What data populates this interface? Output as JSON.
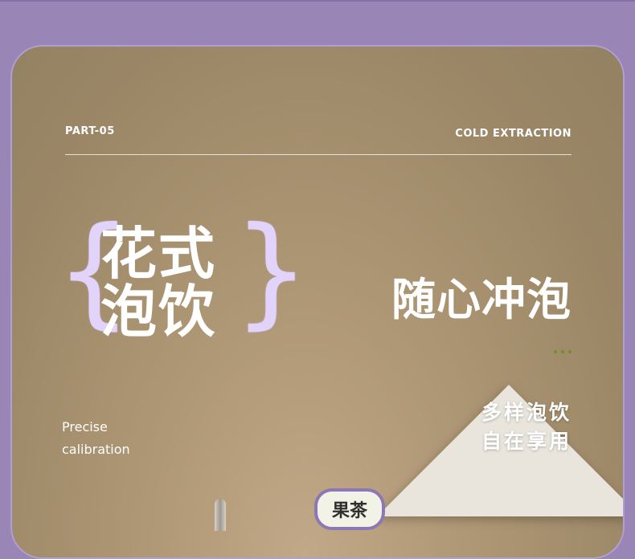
{
  "header": {
    "part": "PART-05",
    "section": "COLD EXTRACTION"
  },
  "title": {
    "line1": "花式",
    "line2": "泡饮",
    "brace_left": "{",
    "brace_right": "}"
  },
  "slogan": "随心冲泡",
  "precise": {
    "line1": "Precise",
    "line2": "calibration"
  },
  "variety": {
    "line1": "多样泡饮",
    "line2": "自在享用"
  },
  "tag": "果茶",
  "colors": {
    "background": "#9a86b6",
    "card": "#ad9674",
    "brace": "#e2d3fa",
    "dots": "#6f8f2a",
    "tag_border": "#8c78b4"
  }
}
